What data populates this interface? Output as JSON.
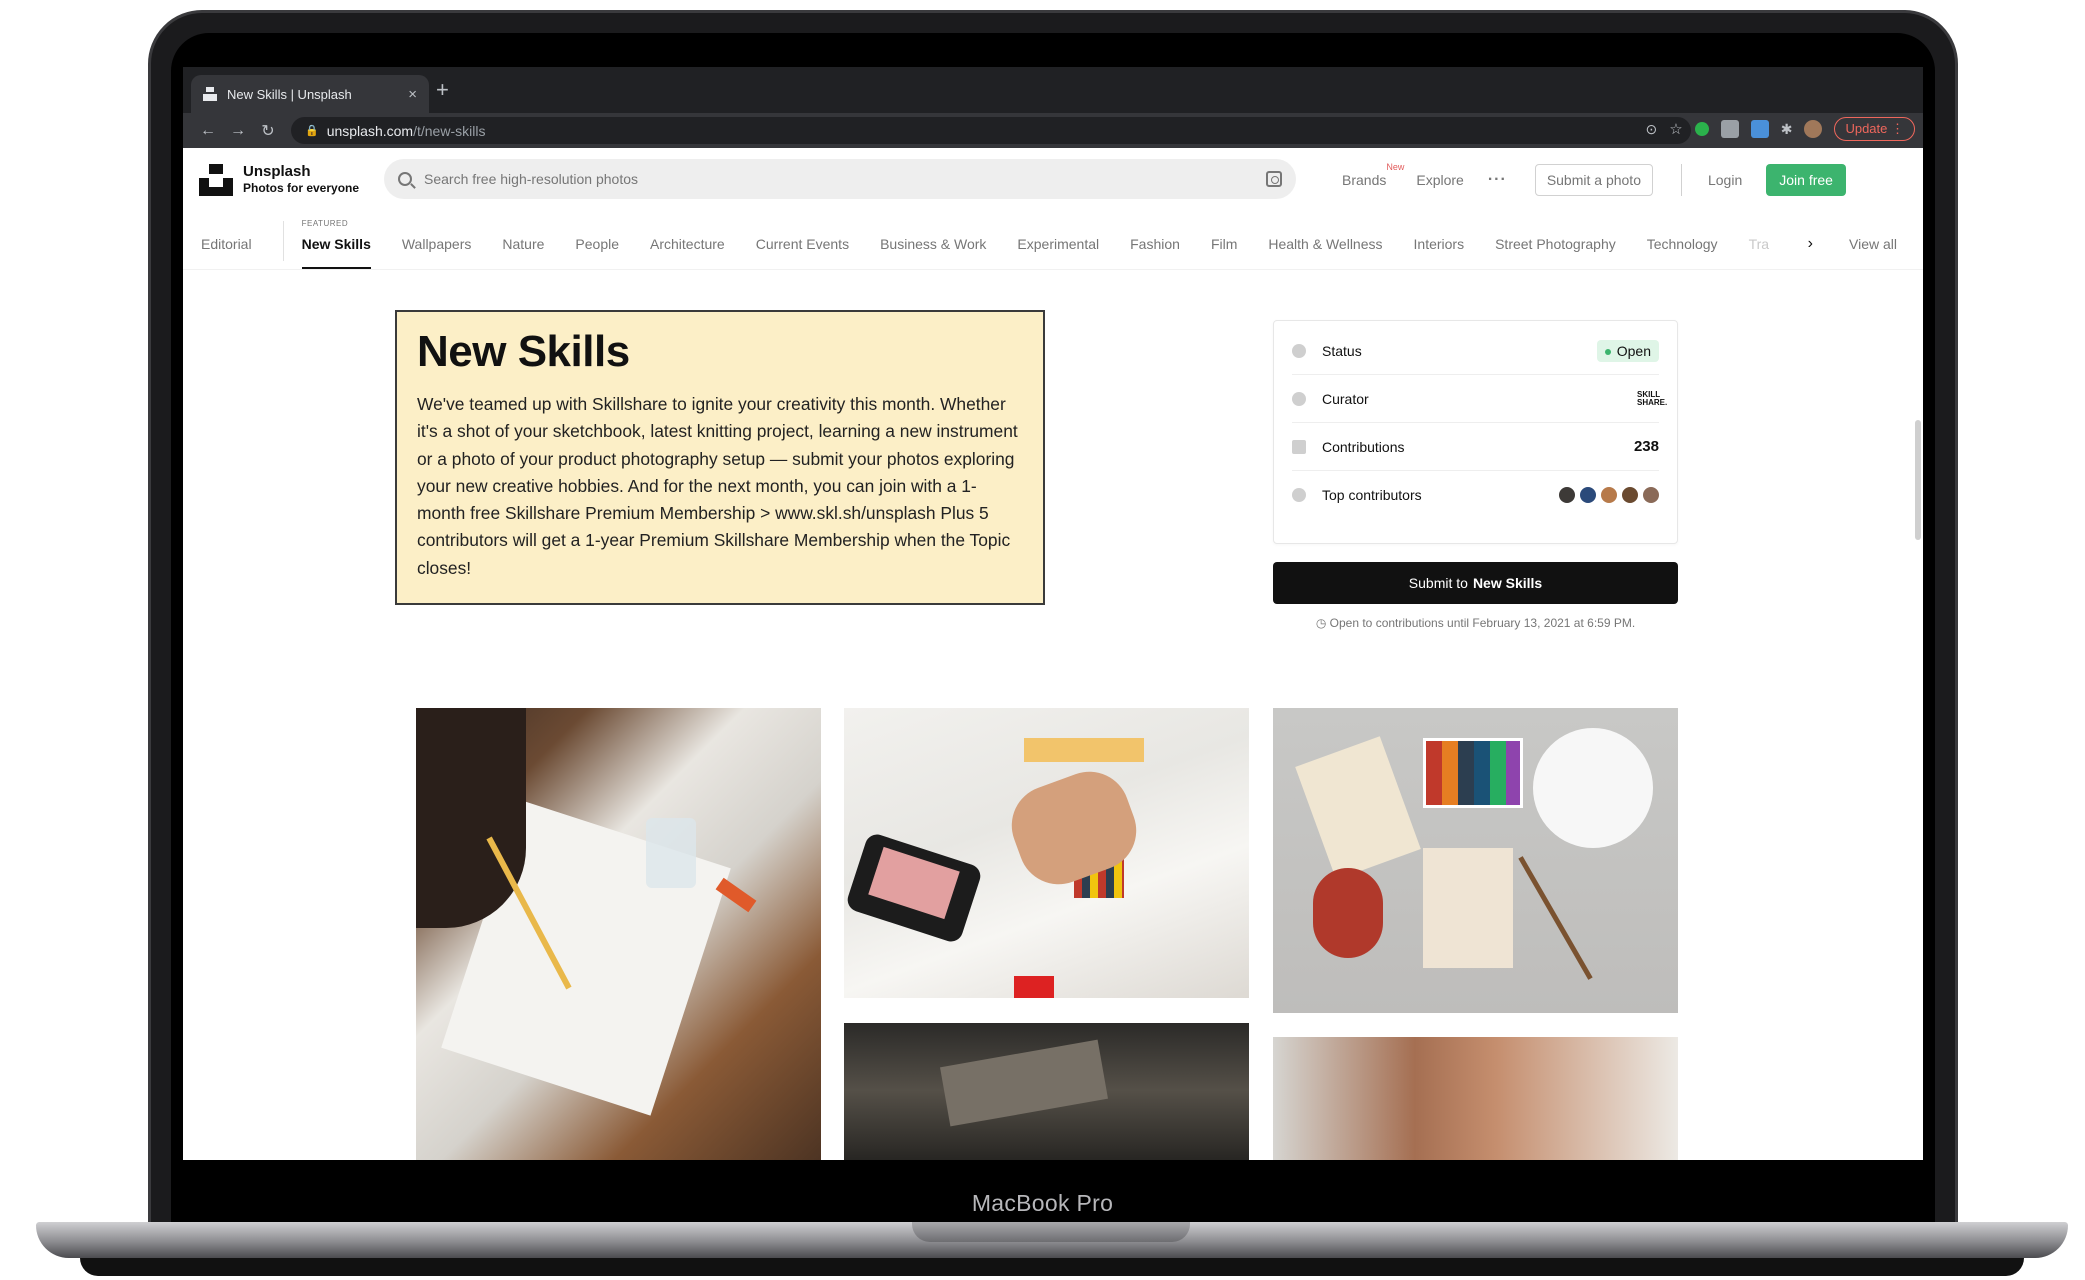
{
  "device": {
    "label": "MacBook Pro"
  },
  "browser": {
    "tab_title": "New Skills | Unsplash",
    "tab_close": "×",
    "new_tab": "+",
    "url_host": "unsplash.com",
    "url_path": "/t/new-skills",
    "back": "←",
    "forward": "→",
    "reload": "↻",
    "update_label": "Update",
    "menu": "⋮"
  },
  "header": {
    "brand_name": "Unsplash",
    "brand_tagline": "Photos for everyone",
    "search_placeholder": "Search free high-resolution photos",
    "brands_label": "Brands",
    "brands_badge": "New",
    "explore_label": "Explore",
    "more_label": "···",
    "submit_photo_label": "Submit a photo",
    "login_label": "Login",
    "join_label": "Join free"
  },
  "topics": {
    "editorial": "Editorial",
    "featured_label": "FEATURED",
    "active": "New Skills",
    "items": [
      "Wallpapers",
      "Nature",
      "People",
      "Architecture",
      "Current Events",
      "Business & Work",
      "Experimental",
      "Fashion",
      "Film",
      "Health & Wellness",
      "Interiors",
      "Street Photography",
      "Technology",
      "Tra"
    ],
    "next_arrow": "›",
    "view_all": "View all"
  },
  "hero": {
    "title": "New Skills",
    "description": "We've teamed up with Skillshare to ignite your creativity this month. Whether it's a shot of your sketchbook, latest knitting project, learning a new instrument or a photo of your product photography setup — submit your photos exploring your new creative hobbies. And for the next month, you can join with a 1-month free Skillshare Premium Membership > www.skl.sh/unsplash Plus 5 contributors will get a 1-year Premium Skillshare Membership when the Topic closes!"
  },
  "info_card": {
    "status_label": "Status",
    "status_value": "Open",
    "curator_label": "Curator",
    "curator_logo": "SKILL SHARE.",
    "contributions_label": "Contributions",
    "contributions_value": "238",
    "top_contributors_label": "Top contributors",
    "status_color": "#3cb46e"
  },
  "submit": {
    "prefix": "Submit to",
    "topic": "New Skills",
    "deadline": "Open to contributions until February 13, 2021 at 6:59 PM."
  },
  "colors": {
    "hero_bg": "#fcefc7",
    "join_button": "#3cb46e",
    "submit_button": "#111111"
  }
}
